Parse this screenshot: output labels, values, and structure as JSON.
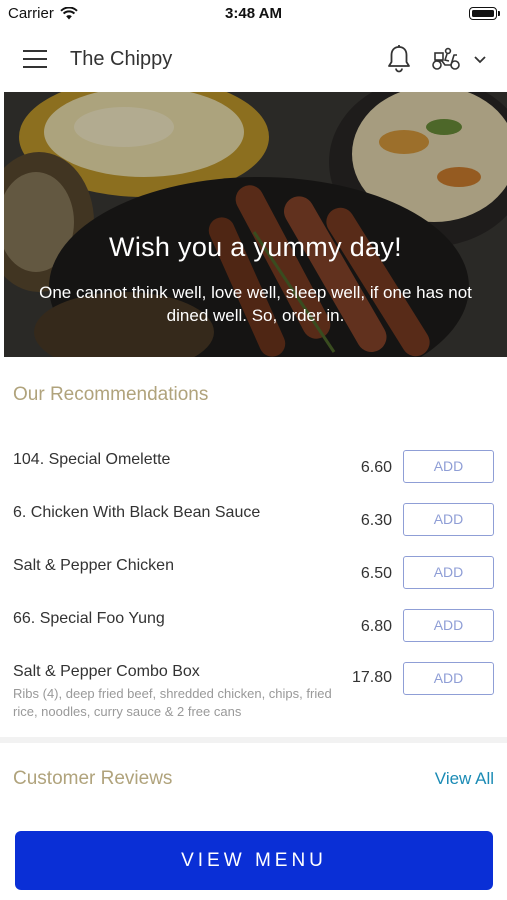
{
  "status_bar": {
    "carrier": "Carrier",
    "time": "3:48 AM"
  },
  "header": {
    "title": "The Chippy",
    "icons": [
      "menu-icon",
      "bell-icon",
      "scooter-icon",
      "chevron-down-icon"
    ]
  },
  "hero": {
    "title": "Wish you a yummy day!",
    "subtitle": "One cannot think well, love well, sleep well, if one has not dined well. So, order in."
  },
  "recommendations": {
    "title": "Our Recommendations",
    "items": [
      {
        "name": "104. Special Omelette",
        "price": "6.60",
        "add_label": "ADD",
        "description": ""
      },
      {
        "name": "6. Chicken With Black Bean Sauce",
        "price": "6.30",
        "add_label": "ADD",
        "description": ""
      },
      {
        "name": "Salt & Pepper Chicken",
        "price": "6.50",
        "add_label": "ADD",
        "description": ""
      },
      {
        "name": "66. Special Foo Yung",
        "price": "6.80",
        "add_label": "ADD",
        "description": ""
      },
      {
        "name": "Salt & Pepper Combo Box",
        "price": "17.80",
        "add_label": "ADD",
        "description": "Ribs (4), deep fried beef, shredded chicken, chips, fried rice, noodles, curry sauce & 2 free cans"
      }
    ]
  },
  "reviews": {
    "title": "Customer Reviews",
    "view_all_label": "View All"
  },
  "footer": {
    "view_menu_label": "VIEW MENU"
  },
  "colors": {
    "accent_gold": "#b0a37c",
    "add_button": "#8f9ed6",
    "link": "#1b8bb5",
    "primary_button": "#0a2fd6"
  }
}
